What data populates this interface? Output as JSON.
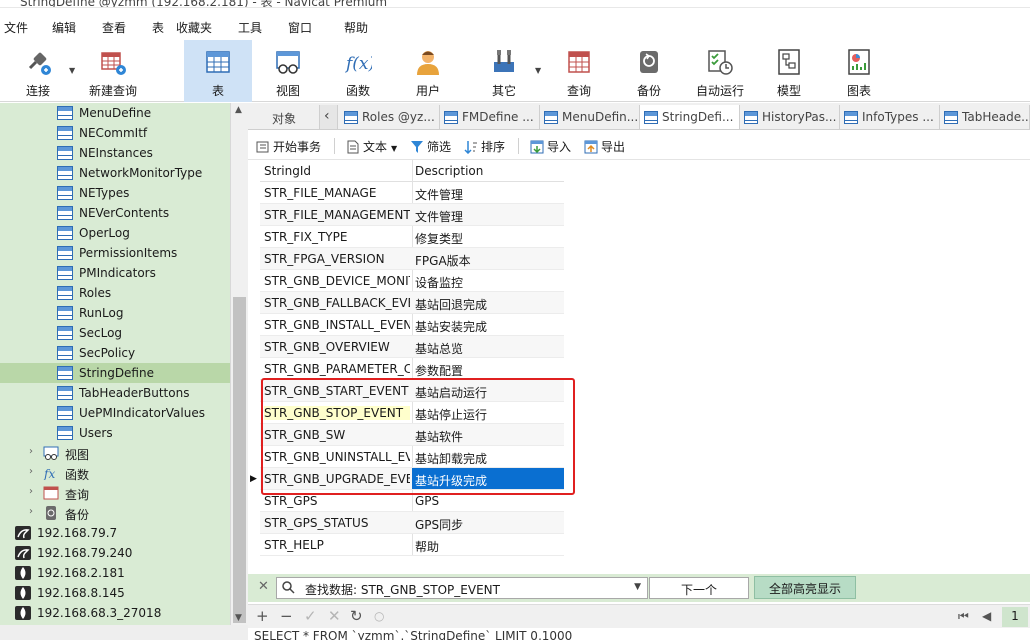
{
  "window": {
    "title": "StringDefine @yzmm (192.168.2.181) - 表 - Navicat Premium"
  },
  "menu": [
    "文件",
    "编辑",
    "查看",
    "表",
    "收藏夹",
    "工具",
    "窗口",
    "帮助"
  ],
  "toolbar": {
    "connect": "连接",
    "new_query": "新建查询",
    "table": "表",
    "view": "视图",
    "function": "函数",
    "user": "用户",
    "other": "其它",
    "query": "查询",
    "backup": "备份",
    "auto_run": "自动运行",
    "model": "模型",
    "chart": "图表"
  },
  "sidebar": {
    "tables": [
      "MenuDefine",
      "NECommItf",
      "NEInstances",
      "NetworkMonitorType",
      "NETypes",
      "NEVerContents",
      "OperLog",
      "PermissionItems",
      "PMIndicators",
      "Roles",
      "RunLog",
      "SecLog",
      "SecPolicy",
      "StringDefine",
      "TabHeaderButtons",
      "UePMIndicatorValues",
      "Users"
    ],
    "selected": "StringDefine",
    "groups": [
      "视图",
      "函数",
      "查询",
      "备份"
    ],
    "connections": [
      "192.168.79.7",
      "192.168.79.240",
      "192.168.2.181",
      "192.168.8.145",
      "192.168.68.3_27018"
    ]
  },
  "tabs": [
    {
      "label": "对象"
    },
    {
      "label": "Roles @yz..."
    },
    {
      "label": "FMDefine ..."
    },
    {
      "label": "MenuDefin..."
    },
    {
      "label": "StringDefi..."
    },
    {
      "label": "HistoryPas..."
    },
    {
      "label": "InfoTypes ..."
    },
    {
      "label": "TabHeade..."
    }
  ],
  "subtoolbar": {
    "begin_tx": "开始事务",
    "text": "文本",
    "filter": "筛选",
    "sort": "排序",
    "import": "导入",
    "export": "导出"
  },
  "grid": {
    "columns": [
      "StringId",
      "Description"
    ],
    "rows": [
      [
        "STR_FILE_MANAGE",
        "文件管理"
      ],
      [
        "STR_FILE_MANAGEMENT",
        "文件管理"
      ],
      [
        "STR_FIX_TYPE",
        "修复类型"
      ],
      [
        "STR_FPGA_VERSION",
        "FPGA版本"
      ],
      [
        "STR_GNB_DEVICE_MONITOR",
        "设备监控"
      ],
      [
        "STR_GNB_FALLBACK_EVENT",
        "基站回退完成"
      ],
      [
        "STR_GNB_INSTALL_EVENT",
        "基站安装完成"
      ],
      [
        "STR_GNB_OVERVIEW",
        "基站总览"
      ],
      [
        "STR_GNB_PARAMETER_CONFIG",
        "参数配置"
      ],
      [
        "STR_GNB_START_EVENT",
        "基站启动运行"
      ],
      [
        "STR_GNB_STOP_EVENT",
        "基站停止运行"
      ],
      [
        "STR_GNB_SW",
        "基站软件"
      ],
      [
        "STR_GNB_UNINSTALL_EVENT",
        "基站卸载完成"
      ],
      [
        "STR_GNB_UPGRADE_EVENT",
        "基站升级完成"
      ],
      [
        "STR_GPS",
        "GPS"
      ],
      [
        "STR_GPS_STATUS",
        "GPS同步"
      ],
      [
        "STR_HELP",
        "帮助"
      ]
    ]
  },
  "find": {
    "label": "查找数据: STR_GNB_STOP_EVENT",
    "next": "下一个",
    "highlight_all": "全部高亮显示"
  },
  "nav": {
    "page": "1"
  },
  "status": {
    "sql": "SELECT * FROM `yzmm`.`StringDefine` LIMIT 0,1000"
  },
  "colors": {
    "sidebar_bg": "#d9ebd4",
    "selection": "#0a6fd1",
    "highlight_box": "#e02020",
    "active_toolbar": "#cfe2f6"
  }
}
